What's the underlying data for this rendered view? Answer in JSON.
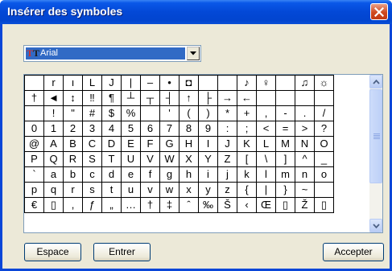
{
  "window": {
    "title": "Insérer des symboles",
    "close_icon": "close-x-icon"
  },
  "font_select": {
    "icon": "truetype-font-icon",
    "icon_text": "T",
    "icon_text2": "T",
    "value": "Arial",
    "dropdown_icon": "chevron-down-icon"
  },
  "symbols": {
    "rows": [
      [
        "",
        "r",
        "ı",
        "L",
        "J",
        "|",
        "–",
        "•",
        "◘",
        "",
        "",
        "♪",
        "♀",
        "",
        "♫",
        "☼"
      ],
      [
        "†",
        "◄",
        "↕",
        "‼",
        "¶",
        "┴",
        "┬",
        "┤",
        "↑",
        "├",
        "→",
        "←",
        "",
        "",
        "",
        ""
      ],
      [
        "",
        "!",
        "\"",
        "#",
        "$",
        "%",
        "",
        "'",
        "(",
        ")",
        "*",
        "+",
        ",",
        "-",
        ".",
        "/"
      ],
      [
        "0",
        "1",
        "2",
        "3",
        "4",
        "5",
        "6",
        "7",
        "8",
        "9",
        ":",
        ";",
        "<",
        "=",
        ">",
        "?"
      ],
      [
        "@",
        "A",
        "B",
        "C",
        "D",
        "E",
        "F",
        "G",
        "H",
        "I",
        "J",
        "K",
        "L",
        "M",
        "N",
        "O"
      ],
      [
        "P",
        "Q",
        "R",
        "S",
        "T",
        "U",
        "V",
        "W",
        "X",
        "Y",
        "Z",
        "[",
        "\\",
        "]",
        "^",
        "_"
      ],
      [
        "`",
        "a",
        "b",
        "c",
        "d",
        "e",
        "f",
        "g",
        "h",
        "i",
        "j",
        "k",
        "l",
        "m",
        "n",
        "o"
      ],
      [
        "p",
        "q",
        "r",
        "s",
        "t",
        "u",
        "v",
        "w",
        "x",
        "y",
        "z",
        "{",
        "|",
        "}",
        "~",
        ""
      ],
      [
        "€",
        "▯",
        ",",
        "ƒ",
        "„",
        "…",
        "†",
        "‡",
        "ˆ",
        "‰",
        "Š",
        "‹",
        "Œ",
        "▯",
        "Ž",
        "▯"
      ]
    ],
    "scroll_up_icon": "scroll-up-arrow-icon",
    "scroll_down_icon": "scroll-down-arrow-icon"
  },
  "buttons": {
    "space": "Espace",
    "enter": "Entrer",
    "accept": "Accepter"
  },
  "colors": {
    "title_bar": "#0348d6",
    "selection": "#316ac5",
    "dialog_bg": "#ece9d8",
    "close_button": "#d04a1e"
  }
}
